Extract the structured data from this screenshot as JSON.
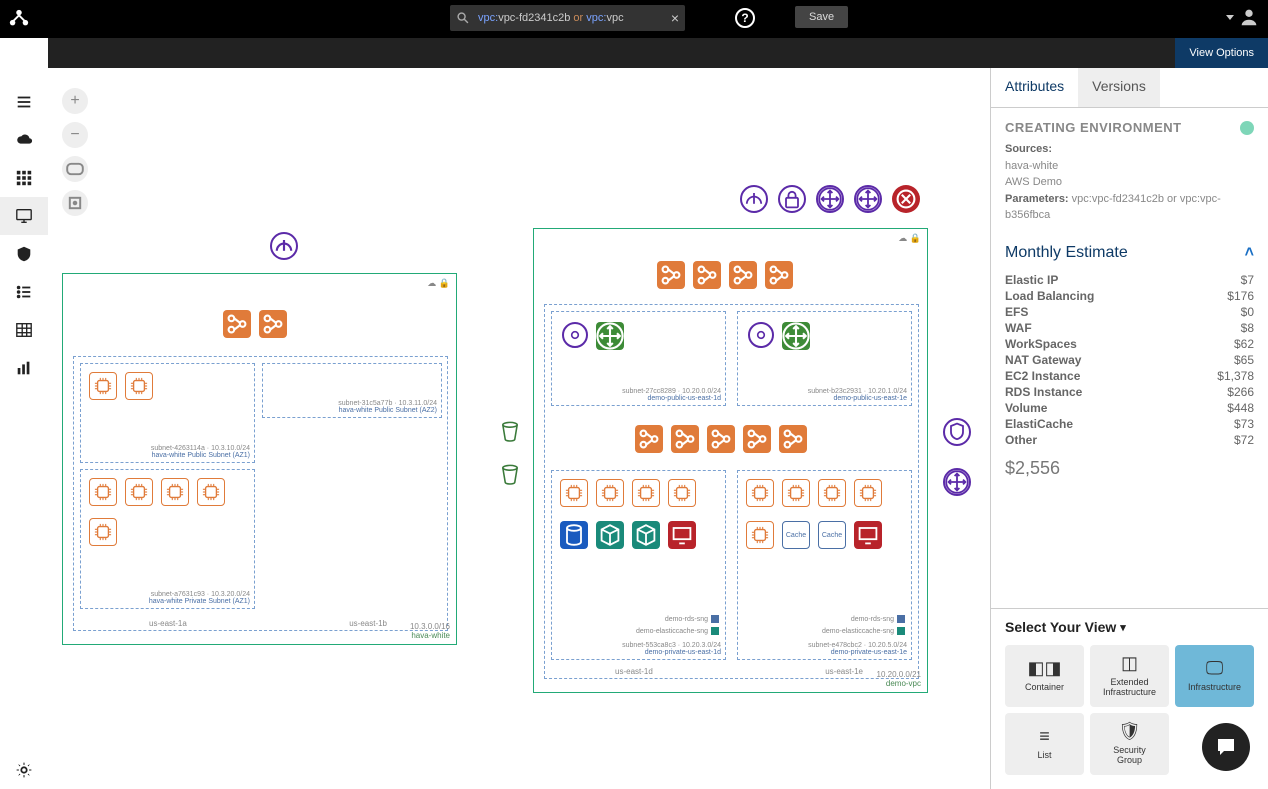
{
  "header": {
    "search_prefix1": "vpc:",
    "search_val1": "vpc-fd2341c2b",
    "search_or": " or ",
    "search_prefix2": "vpc:",
    "search_val2": "vpc",
    "save_label": "Save",
    "view_options_label": "View Options"
  },
  "panel": {
    "tab_attributes": "Attributes",
    "tab_versions": "Versions",
    "env_title": "CREATING ENVIRONMENT",
    "sources_label": "Sources:",
    "source1": "hava-white",
    "source2": "AWS Demo",
    "params_label": "Parameters:",
    "params_value": "vpc:vpc-fd2341c2b or vpc:vpc-b356fbca",
    "estimate_title": "Monthly Estimate",
    "estimate": [
      {
        "k": "Elastic IP",
        "v": "$7"
      },
      {
        "k": "Load Balancing",
        "v": "$176"
      },
      {
        "k": "EFS",
        "v": "$0"
      },
      {
        "k": "WAF",
        "v": "$8"
      },
      {
        "k": "WorkSpaces",
        "v": "$62"
      },
      {
        "k": "NAT Gateway",
        "v": "$65"
      },
      {
        "k": "EC2 Instance",
        "v": "$1,378"
      },
      {
        "k": "RDS Instance",
        "v": "$266"
      },
      {
        "k": "Volume",
        "v": "$448"
      },
      {
        "k": "ElastiCache",
        "v": "$73"
      },
      {
        "k": "Other",
        "v": "$72"
      }
    ],
    "estimate_total": "$2,556",
    "select_view_label": "Select Your View",
    "views": {
      "container": "Container",
      "extended": "Extended\nInfrastructure",
      "infrastructure": "Infrastructure",
      "list": "List",
      "security": "Security\nGroup"
    }
  },
  "diagram": {
    "region1": {
      "vpc_label": "hava-white",
      "vpc_cidr": "10.3.0.0/16",
      "az_a": "us-east-1a",
      "az_b": "us-east-1b",
      "sub_pub_az1_id": "subnet-4263114a · 10.3.10.0/24",
      "sub_pub_az1_name": "hava-white Public Subnet (AZ1)",
      "sub_pub_az2_id": "subnet-31c5a77b · 10.3.11.0/24",
      "sub_pub_az2_name": "hava-white Public Subnet (AZ2)",
      "sub_priv_az1_id": "subnet-a7631c93 · 10.3.20.0/24",
      "sub_priv_az1_name": "hava-white Private Subnet (AZ1)"
    },
    "region2": {
      "vpc_label": "demo-vpc",
      "vpc_cidr": "10.20.0.0/21",
      "az_d": "us-east-1d",
      "az_e": "us-east-1e",
      "sub_pub_d_id": "subnet-27cc8289 · 10.20.0.0/24",
      "sub_pub_d_name": "demo-public-us-east-1d",
      "sub_pub_e_id": "subnet-b23c2931 · 10.20.1.0/24",
      "sub_pub_e_name": "demo-public-us-east-1e",
      "sub_priv_d_id": "subnet-553ca8c3 · 10.20.3.0/24",
      "sub_priv_d_name": "demo-private-us-east-1d",
      "sub_priv_e_id": "subnet-e478cbc2 · 10.20.5.0/24",
      "sub_priv_e_name": "demo-private-us-east-1e",
      "sng_rds": "demo-rds-sng",
      "sng_cache": "demo-elasticcache-sng",
      "cache_label": "Cache"
    }
  }
}
